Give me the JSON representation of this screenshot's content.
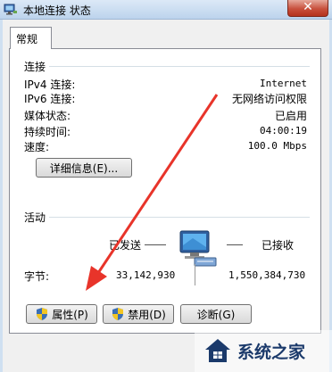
{
  "window": {
    "title": "本地连接 状态",
    "close_glyph": "✕"
  },
  "tab": {
    "label": "常规"
  },
  "connection": {
    "group_label": "连接",
    "rows": [
      {
        "label": "IPv4 连接:",
        "value": "Internet"
      },
      {
        "label": "IPv6 连接:",
        "value": "无网络访问权限"
      },
      {
        "label": "媒体状态:",
        "value": "已启用"
      },
      {
        "label": "持续时间:",
        "value": "04:00:19"
      },
      {
        "label": "速度:",
        "value": "100.0 Mbps"
      }
    ],
    "details_button": "详细信息(E)..."
  },
  "activity": {
    "group_label": "活动",
    "sent_label": "已发送",
    "received_label": "已接收",
    "bytes_label": "字节:",
    "bytes_sent": "33,142,930",
    "bytes_received": "1,550,384,730"
  },
  "buttons": {
    "properties": "属性(P)",
    "disable": "禁用(D)",
    "diagnose": "诊断(G)"
  },
  "watermark": {
    "text": "系统之家"
  },
  "colors": {
    "arrow": "#e8342a",
    "title_bar": "#bcd3ec",
    "close": "#c8503c"
  }
}
